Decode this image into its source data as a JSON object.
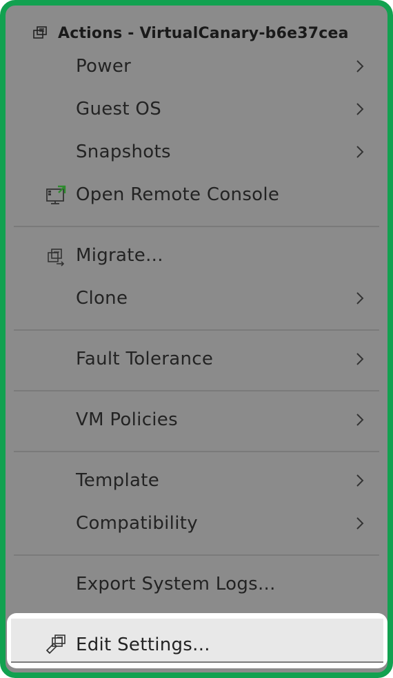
{
  "header": {
    "title": "Actions - VirtualCanary-b6e37cea",
    "icon": "vm-icon"
  },
  "groups": [
    {
      "items": [
        {
          "label": "Power",
          "icon": "",
          "submenu": true
        },
        {
          "label": "Guest OS",
          "icon": "",
          "submenu": true
        },
        {
          "label": "Snapshots",
          "icon": "",
          "submenu": true
        },
        {
          "label": "Open Remote Console",
          "icon": "remote-console-icon",
          "submenu": false
        }
      ]
    },
    {
      "items": [
        {
          "label": "Migrate...",
          "icon": "migrate-icon",
          "submenu": false
        },
        {
          "label": "Clone",
          "icon": "",
          "submenu": true
        }
      ]
    },
    {
      "items": [
        {
          "label": "Fault Tolerance",
          "icon": "",
          "submenu": true
        }
      ]
    },
    {
      "items": [
        {
          "label": "VM Policies",
          "icon": "",
          "submenu": true
        }
      ]
    },
    {
      "items": [
        {
          "label": "Template",
          "icon": "",
          "submenu": true
        },
        {
          "label": "Compatibility",
          "icon": "",
          "submenu": true
        }
      ]
    },
    {
      "items": [
        {
          "label": "Export System Logs...",
          "icon": "",
          "submenu": false
        }
      ]
    },
    {
      "items": [
        {
          "label": "Edit Settings...",
          "icon": "edit-settings-icon",
          "submenu": false,
          "highlighted": true
        }
      ]
    }
  ],
  "colors": {
    "frame_border": "#12a150",
    "overlay": "#8b8b8b",
    "highlight": "#e8e8e8",
    "console_accent": "#2e8b2e"
  }
}
